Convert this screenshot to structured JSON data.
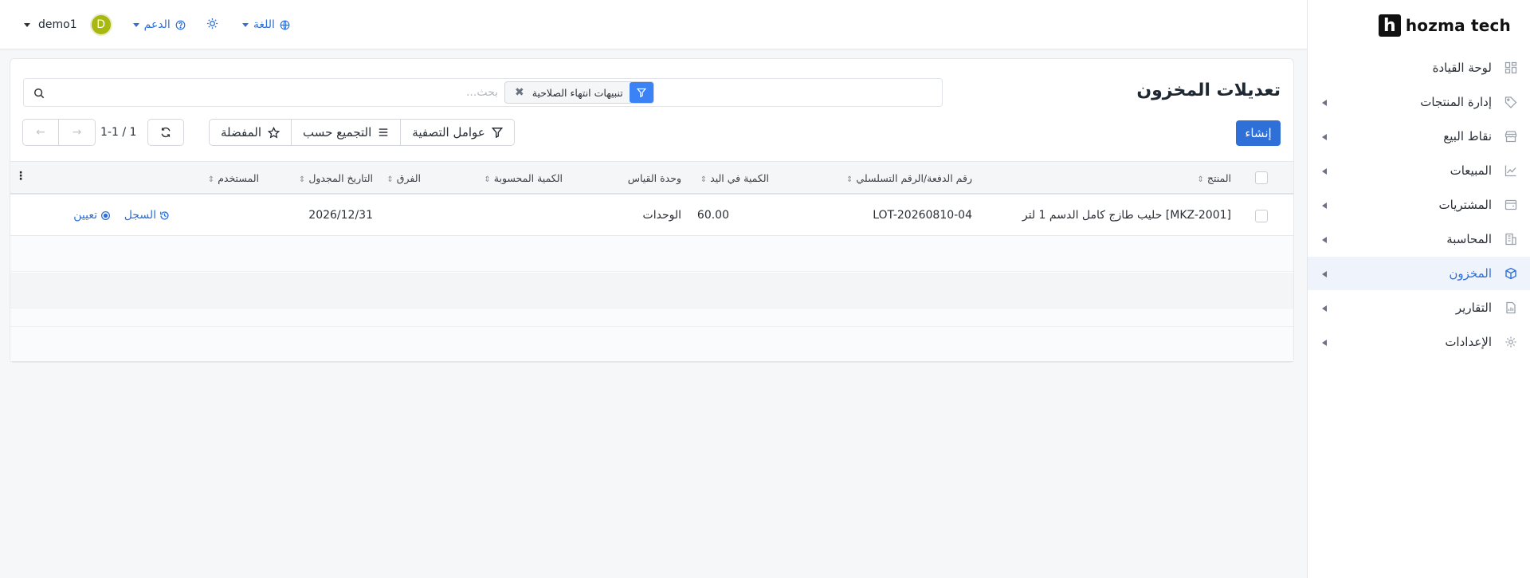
{
  "app": {
    "logo_letter": "h",
    "logo_text": "hozma tech"
  },
  "header": {
    "user_name": "demo1",
    "avatar_letter": "D",
    "support_label": "الدعم",
    "language_label": "اللغة"
  },
  "sidebar": {
    "items": [
      {
        "label": "لوحة القيادة",
        "icon": "dashboard-icon",
        "active": false
      },
      {
        "label": "إدارة المنتجات",
        "icon": "tag-icon",
        "active": false
      },
      {
        "label": "نقاط البيع",
        "icon": "store-icon",
        "active": false
      },
      {
        "label": "المبيعات",
        "icon": "chart-line-icon",
        "active": false
      },
      {
        "label": "المشتريات",
        "icon": "wallet-icon",
        "active": false
      },
      {
        "label": "المحاسبة",
        "icon": "building-icon",
        "active": false
      },
      {
        "label": "المخزون",
        "icon": "box-icon",
        "active": true
      },
      {
        "label": "التقارير",
        "icon": "report-icon",
        "active": false
      },
      {
        "label": "الإعدادات",
        "icon": "gear-icon",
        "active": false
      }
    ]
  },
  "page": {
    "title": "تعديلات المخزون",
    "search_placeholder": "بحث...",
    "active_filter": "تنبيهات انتهاء الصلاحية",
    "create_label": "إنشاء",
    "filters_label": "عوامل التصفية",
    "group_by_label": "التجميع حسب",
    "favorites_label": "المفضلة",
    "pager_text": "1-1 / 1"
  },
  "table": {
    "columns": [
      "المنتج",
      "رقم الدفعة/الرقم التسلسلي",
      "الكمية في اليد",
      "وحدة القياس",
      "الكمية المحسوبة",
      "الفرق",
      "التاريخ المجدول",
      "المستخدم"
    ],
    "rows": [
      {
        "product": "[MKZ-2001] حليب طازج كامل الدسم 1 لتر",
        "lot": "LOT-20260810-04",
        "on_hand": "60.00",
        "uom": "الوحدات",
        "counted": "",
        "difference": "",
        "scheduled_date": "2026/12/31",
        "user": "",
        "history_label": "السجل",
        "apply_label": "تعيين"
      }
    ]
  },
  "colors": {
    "accent": "#2f6fd8",
    "filter_chip": "#3b82f6",
    "avatar": "#a7b80e"
  }
}
